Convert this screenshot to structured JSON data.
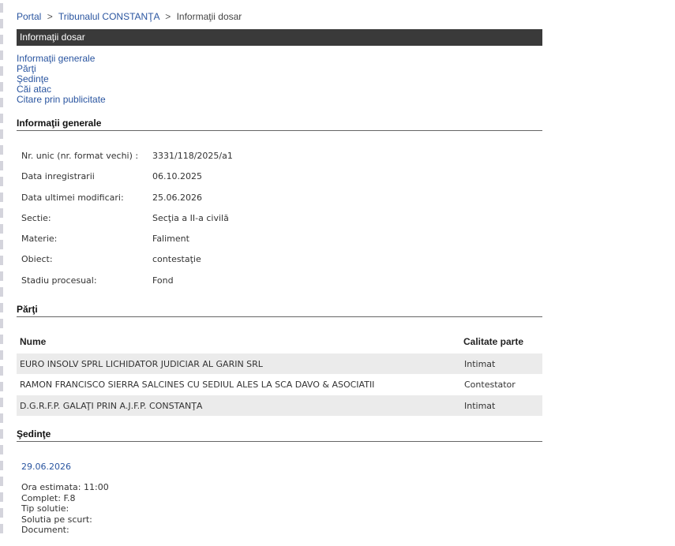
{
  "breadcrumb": {
    "portal": "Portal",
    "sep": ">",
    "court": "Tribunalul CONSTANŢA",
    "current": "Informaţii dosar"
  },
  "title": "Informaţii dosar",
  "nav": {
    "items": [
      "Informaţii generale",
      "Părţi",
      "Şedinţe",
      "Căi atac",
      "Citare prin publicitate"
    ]
  },
  "general": {
    "heading": "Informaţii generale",
    "rows": [
      {
        "label": "Nr. unic (nr. format vechi) :",
        "value": "3331/118/2025/a1"
      },
      {
        "label": "Data inregistrarii",
        "value": "06.10.2025"
      },
      {
        "label": "Data ultimei modificari:",
        "value": "25.06.2026"
      },
      {
        "label": "Sectie:",
        "value": "Secţia a II-a civilă"
      },
      {
        "label": "Materie:",
        "value": "Faliment"
      },
      {
        "label": "Obiect:",
        "value": "contestaţie"
      },
      {
        "label": "Stadiu procesual:",
        "value": "Fond"
      }
    ]
  },
  "parti": {
    "heading": "Părţi",
    "col_name": "Nume",
    "col_role": "Calitate parte",
    "rows": [
      {
        "name": "EURO INSOLV SPRL LICHIDATOR JUDICIAR AL GARIN SRL",
        "role": "Intimat"
      },
      {
        "name": "RAMON FRANCISCO SIERRA SALCINES CU SEDIUL ALES LA SCA DAVO & ASOCIATII",
        "role": "Contestator"
      },
      {
        "name": "D.G.R.F.P. GALAŢI PRIN A.J.F.P. CONSTANŢA",
        "role": "Intimat"
      }
    ]
  },
  "sedinte": {
    "heading": "Şedinţe",
    "date": "29.06.2026",
    "lines": [
      "Ora estimata: 11:00",
      "Complet: F.8",
      "Tip solutie:",
      "Solutia pe scurt:",
      "Document:"
    ]
  }
}
